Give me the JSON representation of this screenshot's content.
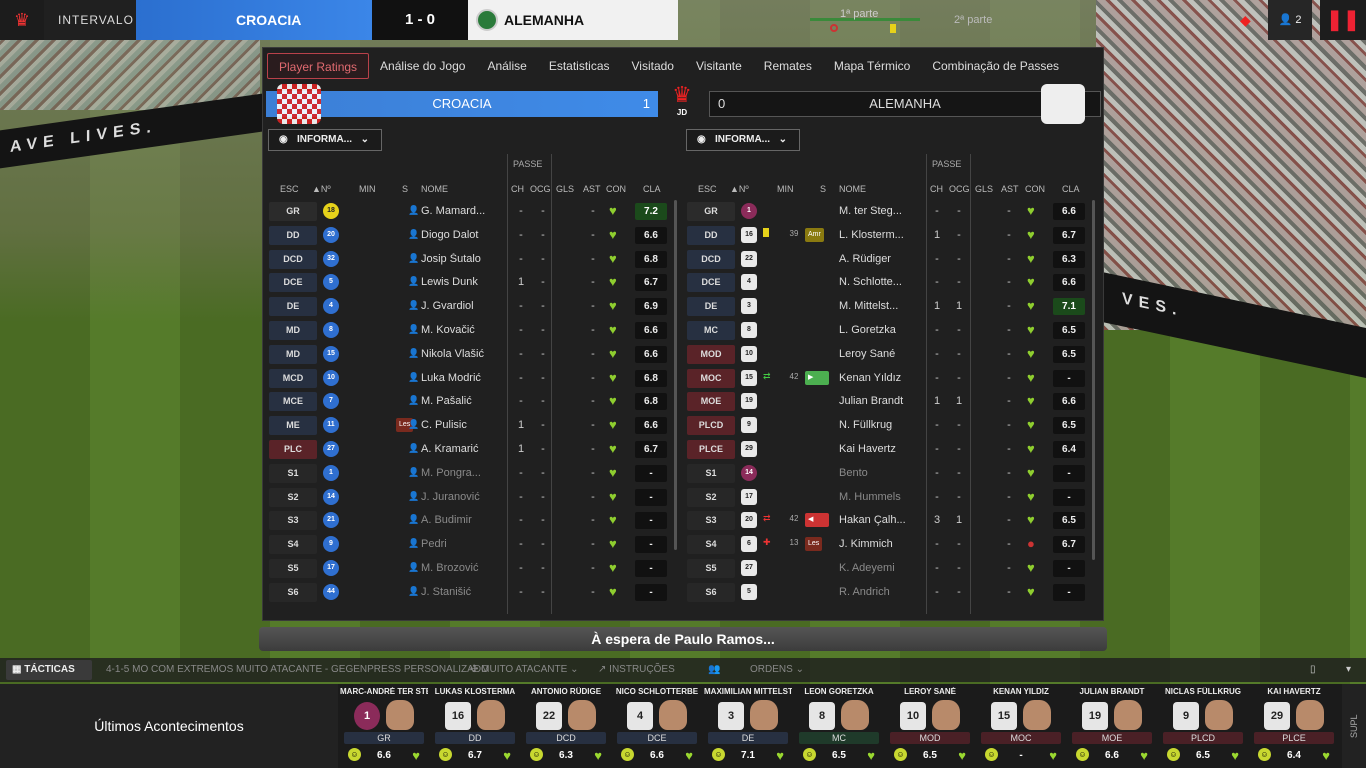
{
  "topbar": {
    "status": "INTERVALO",
    "home_team": "CROACIA",
    "score": "1 - 0",
    "away_team": "ALEMANHA",
    "timeline_label": "1ª parte",
    "half2_label": "2ª parte",
    "people_count": "2"
  },
  "tabs": [
    "Player Ratings",
    "Análise do Jogo",
    "Análise",
    "Estatisticas",
    "Visitado",
    "Visitante",
    "Remates",
    "Mapa Térmico",
    "Combinação de Passes"
  ],
  "home": {
    "name": "CROACIA",
    "score": "1",
    "dropdown": "INFORMA..."
  },
  "away": {
    "name": "ALEMANHA",
    "score": "0",
    "dropdown": "INFORMA..."
  },
  "club_badge_text": "JD",
  "headers": {
    "passe": "PASSE",
    "esc": "ESC",
    "num": "Nº",
    "min": "MIN",
    "s": "S",
    "nome": "NOME",
    "ch": "CH",
    "ocg": "OCG",
    "gls": "GLS",
    "ast": "AST",
    "con": "CON",
    "cla": "CLA"
  },
  "home_players": [
    {
      "pos": "GR",
      "num": "18",
      "name": "G. Mamard...",
      "ch": "-",
      "ocg": "-",
      "gls": "",
      "ast": "-",
      "cla": "7.2",
      "kind": "gk",
      "best": true
    },
    {
      "pos": "DD",
      "num": "20",
      "name": "Diogo Dalot",
      "ch": "-",
      "ocg": "-",
      "gls": "",
      "ast": "-",
      "cla": "6.6",
      "kind": "def"
    },
    {
      "pos": "DCD",
      "num": "32",
      "name": "Josip Šutalo",
      "ch": "-",
      "ocg": "-",
      "gls": "",
      "ast": "-",
      "cla": "6.8",
      "kind": "def"
    },
    {
      "pos": "DCE",
      "num": "5",
      "name": "Lewis Dunk",
      "ch": "1",
      "ocg": "-",
      "gls": "",
      "ast": "-",
      "cla": "6.7",
      "kind": "def"
    },
    {
      "pos": "DE",
      "num": "4",
      "name": "J. Gvardiol",
      "ch": "-",
      "ocg": "-",
      "gls": "",
      "ast": "-",
      "cla": "6.9",
      "kind": "def"
    },
    {
      "pos": "MD",
      "num": "8",
      "name": "M. Kovačić",
      "ch": "-",
      "ocg": "-",
      "gls": "",
      "ast": "-",
      "cla": "6.6",
      "kind": "def"
    },
    {
      "pos": "MD",
      "num": "15",
      "name": "Nikola Vlašić",
      "ch": "-",
      "ocg": "-",
      "gls": "",
      "ast": "-",
      "cla": "6.6",
      "kind": "def"
    },
    {
      "pos": "MCD",
      "num": "10",
      "name": "Luka Modrić",
      "ch": "-",
      "ocg": "-",
      "gls": "",
      "ast": "-",
      "cla": "6.8",
      "kind": "def"
    },
    {
      "pos": "MCE",
      "num": "7",
      "name": "M. Pašalić",
      "ch": "-",
      "ocg": "-",
      "gls": "",
      "ast": "-",
      "cla": "6.8",
      "kind": "def"
    },
    {
      "pos": "ME",
      "num": "11",
      "name": "C. Pulisic",
      "ch": "1",
      "ocg": "-",
      "gls": "",
      "ast": "-",
      "cla": "6.6",
      "kind": "def",
      "tag": "Les"
    },
    {
      "pos": "PLC",
      "num": "27",
      "name": "A. Kramarić",
      "ch": "1",
      "ocg": "-",
      "gls": "",
      "ast": "-",
      "cla": "6.7",
      "kind": "atk"
    },
    {
      "pos": "S1",
      "num": "1",
      "name": "M. Pongra...",
      "ch": "-",
      "ocg": "-",
      "gls": "",
      "ast": "-",
      "cla": "-",
      "kind": "sub"
    },
    {
      "pos": "S2",
      "num": "14",
      "name": "J. Juranović",
      "ch": "-",
      "ocg": "-",
      "gls": "",
      "ast": "-",
      "cla": "-",
      "kind": "sub"
    },
    {
      "pos": "S3",
      "num": "21",
      "name": "A. Budimir",
      "ch": "-",
      "ocg": "-",
      "gls": "",
      "ast": "-",
      "cla": "-",
      "kind": "sub"
    },
    {
      "pos": "S4",
      "num": "9",
      "name": "Pedri",
      "ch": "-",
      "ocg": "-",
      "gls": "",
      "ast": "-",
      "cla": "-",
      "kind": "sub"
    },
    {
      "pos": "S5",
      "num": "17",
      "name": "M. Brozović",
      "ch": "-",
      "ocg": "-",
      "gls": "",
      "ast": "-",
      "cla": "-",
      "kind": "sub"
    },
    {
      "pos": "S6",
      "num": "44",
      "name": "J. Stanišić",
      "ch": "-",
      "ocg": "-",
      "gls": "",
      "ast": "-",
      "cla": "-",
      "kind": "sub"
    }
  ],
  "away_players": [
    {
      "pos": "GR",
      "num": "1",
      "name": "M. ter Steg...",
      "min": "",
      "ch": "-",
      "ocg": "-",
      "ast": "-",
      "cla": "6.6",
      "kind": "gk"
    },
    {
      "pos": "DD",
      "num": "16",
      "name": "L. Klosterm...",
      "min": "39",
      "ch": "1",
      "ocg": "-",
      "ast": "-",
      "cla": "6.7",
      "kind": "def",
      "tag": "Amr",
      "card": "yellow"
    },
    {
      "pos": "DCD",
      "num": "22",
      "name": "A. Rüdiger",
      "min": "",
      "ch": "-",
      "ocg": "-",
      "ast": "-",
      "cla": "6.3",
      "kind": "def"
    },
    {
      "pos": "DCE",
      "num": "4",
      "name": "N. Schlotte...",
      "min": "",
      "ch": "-",
      "ocg": "-",
      "ast": "-",
      "cla": "6.6",
      "kind": "def"
    },
    {
      "pos": "DE",
      "num": "3",
      "name": "M. Mittelst...",
      "min": "",
      "ch": "1",
      "ocg": "1",
      "ast": "-",
      "cla": "7.1",
      "kind": "def",
      "best": true
    },
    {
      "pos": "MC",
      "num": "8",
      "name": "L. Goretzka",
      "min": "",
      "ch": "-",
      "ocg": "-",
      "ast": "-",
      "cla": "6.5",
      "kind": "mid"
    },
    {
      "pos": "MOD",
      "num": "10",
      "name": "Leroy Sané",
      "min": "",
      "ch": "-",
      "ocg": "-",
      "ast": "-",
      "cla": "6.5",
      "kind": "atk"
    },
    {
      "pos": "MOC",
      "num": "15",
      "name": "Kenan Yıldız",
      "min": "42",
      "ch": "-",
      "ocg": "-",
      "ast": "-",
      "cla": "-",
      "kind": "atk",
      "sub_in": true
    },
    {
      "pos": "MOE",
      "num": "19",
      "name": "Julian Brandt",
      "min": "",
      "ch": "1",
      "ocg": "1",
      "ast": "-",
      "cla": "6.6",
      "kind": "atk"
    },
    {
      "pos": "PLCD",
      "num": "9",
      "name": "N. Füllkrug",
      "min": "",
      "ch": "-",
      "ocg": "-",
      "ast": "-",
      "cla": "6.5",
      "kind": "atk"
    },
    {
      "pos": "PLCE",
      "num": "29",
      "name": "Kai Havertz",
      "min": "",
      "ch": "-",
      "ocg": "-",
      "ast": "-",
      "cla": "6.4",
      "kind": "atk"
    },
    {
      "pos": "S1",
      "num": "14",
      "name": "Bento",
      "min": "",
      "ch": "-",
      "ocg": "-",
      "ast": "-",
      "cla": "-",
      "kind": "sub"
    },
    {
      "pos": "S2",
      "num": "17",
      "name": "M. Hummels",
      "min": "",
      "ch": "-",
      "ocg": "-",
      "ast": "-",
      "cla": "-",
      "kind": "sub"
    },
    {
      "pos": "S3",
      "num": "20",
      "name": "Hakan Çalh...",
      "min": "42",
      "ch": "3",
      "ocg": "1",
      "ast": "-",
      "cla": "6.5",
      "kind": "sub",
      "sub_out": true
    },
    {
      "pos": "S4",
      "num": "6",
      "name": "J. Kimmich",
      "min": "13",
      "ch": "-",
      "ocg": "-",
      "ast": "-",
      "cla": "6.7",
      "kind": "sub",
      "tag": "Les"
    },
    {
      "pos": "S5",
      "num": "27",
      "name": "K. Adeyemi",
      "min": "",
      "ch": "-",
      "ocg": "-",
      "ast": "-",
      "cla": "-",
      "kind": "sub"
    },
    {
      "pos": "S6",
      "num": "5",
      "name": "R. Andrich",
      "min": "",
      "ch": "-",
      "ocg": "-",
      "ast": "-",
      "cla": "-",
      "kind": "sub"
    }
  ],
  "waiting_text": "À espera de Paulo Ramos...",
  "tacticbar": {
    "tactics_label": "TÁCTICAS",
    "formation": "4-1-5 MO COM EXTREMOS MUITO ATACANTE - GEGENPRESS PERSONALIZADO",
    "mentality": "MUITO ATACANTE",
    "instructions": "INSTRUÇÕES",
    "orders": "ORDENS"
  },
  "bottom": {
    "ultimos": "Últimos Acontecimentos",
    "supl": "SUPL",
    "cards": [
      {
        "name": "MARC-ANDRÉ TER STE",
        "num": "1",
        "pos": "GR",
        "rating": "6.6",
        "kind": "gk"
      },
      {
        "name": "LUKAS KLOSTERMA",
        "num": "16",
        "pos": "DD",
        "rating": "6.7",
        "kind": "def"
      },
      {
        "name": "ANTONIO RÜDIGE",
        "num": "22",
        "pos": "DCD",
        "rating": "6.3",
        "kind": "def"
      },
      {
        "name": "NICO SCHLOTTERBE",
        "num": "4",
        "pos": "DCE",
        "rating": "6.6",
        "kind": "def"
      },
      {
        "name": "MAXIMILIAN MITTELST",
        "num": "3",
        "pos": "DE",
        "rating": "7.1",
        "kind": "def"
      },
      {
        "name": "LEON GORETZKA",
        "num": "8",
        "pos": "MC",
        "rating": "6.5",
        "kind": "mid"
      },
      {
        "name": "LEROY SANÉ",
        "num": "10",
        "pos": "MOD",
        "rating": "6.5",
        "kind": "atk"
      },
      {
        "name": "KENAN YILDIZ",
        "num": "15",
        "pos": "MOC",
        "rating": "-",
        "kind": "atk"
      },
      {
        "name": "JULIAN BRANDT",
        "num": "19",
        "pos": "MOE",
        "rating": "6.6",
        "kind": "atk"
      },
      {
        "name": "NICLAS FÜLLKRUG",
        "num": "9",
        "pos": "PLCD",
        "rating": "6.5",
        "kind": "atk"
      },
      {
        "name": "KAI HAVERTZ",
        "num": "29",
        "pos": "PLCE",
        "rating": "6.4",
        "kind": "atk"
      }
    ]
  },
  "colors": {
    "home": "#3c7fd6",
    "accent": "#c0392b",
    "rating_good": "#1b4a1b",
    "heart": "#9ad830"
  }
}
